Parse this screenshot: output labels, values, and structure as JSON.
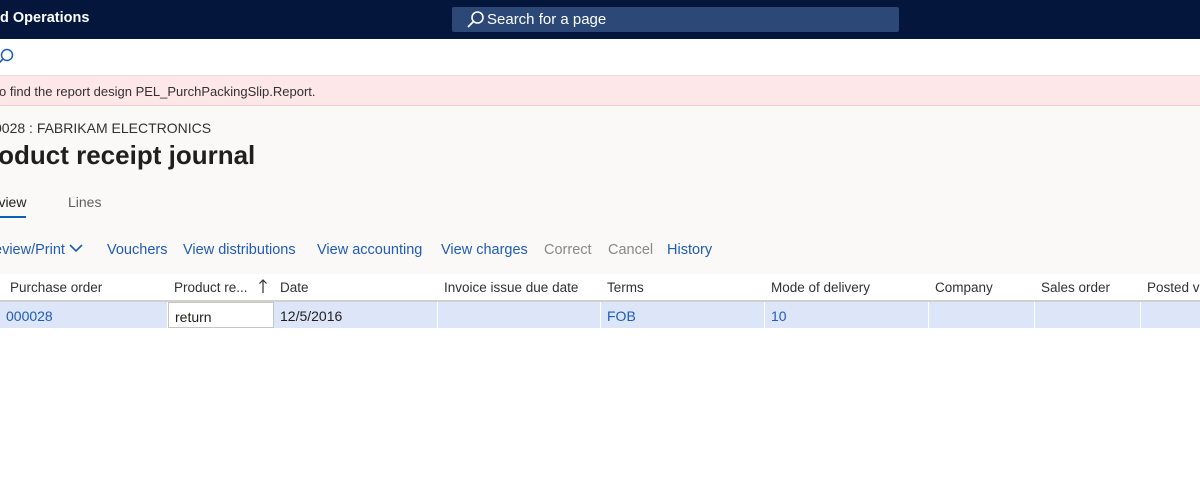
{
  "topbar": {
    "app_title": "d Operations",
    "search_placeholder": "Search for a page",
    "search_icon": "search-icon"
  },
  "actionbar": {
    "search_icon": "search-icon"
  },
  "message": {
    "text": "o find the report design PEL_PurchPackingSlip.Report."
  },
  "page": {
    "caption": "0028 : FABRIKAM ELECTRONICS",
    "title": "roduct receipt journal"
  },
  "tabs": [
    {
      "label": "erview",
      "selected": true
    },
    {
      "label": "Lines",
      "selected": false
    }
  ],
  "commands": [
    {
      "label": "eview/Print",
      "enabled": true,
      "dropdown": true
    },
    {
      "label": "Vouchers",
      "enabled": true
    },
    {
      "label": "View distributions",
      "enabled": true
    },
    {
      "label": "View accounting",
      "enabled": true
    },
    {
      "label": "View charges",
      "enabled": true
    },
    {
      "label": "Correct",
      "enabled": false
    },
    {
      "label": "Cancel",
      "enabled": false
    },
    {
      "label": "History",
      "enabled": true
    }
  ],
  "grid": {
    "columns": [
      "Purchase order",
      "Product re...",
      "Date",
      "Invoice issue due date",
      "Terms",
      "Mode of delivery",
      "Company",
      "Sales order",
      "Posted v"
    ],
    "sorted_column": "Product re...",
    "sort_direction": "ascending",
    "rows": [
      [
        "000028",
        "return",
        "12/5/2016",
        "",
        "FOB",
        "10",
        "",
        "",
        ""
      ]
    ]
  },
  "colors": {
    "topbar": "#04163c",
    "search_box": "#2b4876",
    "link": "#1f5bb8",
    "error_bar": "#fde7e9",
    "selected_row": "#dce6f8"
  }
}
